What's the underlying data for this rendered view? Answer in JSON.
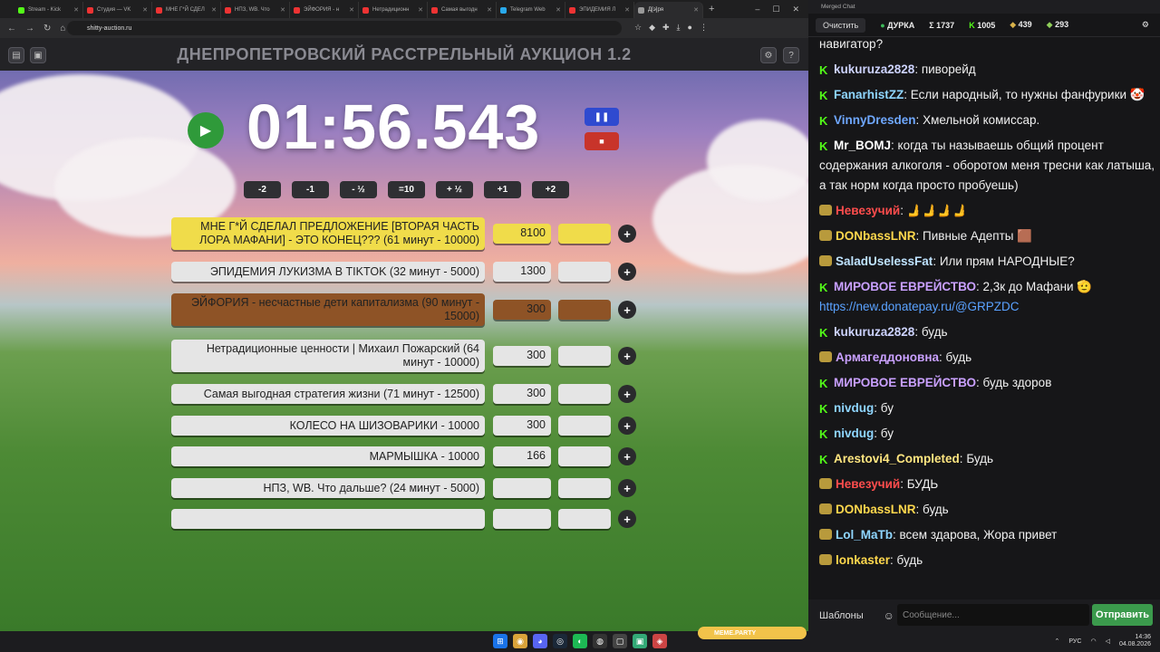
{
  "browser": {
    "tabs": [
      "Stream - Kick",
      "Студия — VK",
      "МНЕ Г*Й СДЕЛ",
      "НПЗ, WB. Что",
      "ЭЙФОРИЯ - н",
      "Нетрадиционн",
      "Самая выгодн",
      "Telegram Web",
      "ЭПИДЕМИЯ Л",
      "Д[э]ря"
    ],
    "url": "shitty-auction.ru"
  },
  "app": {
    "title": "ДНЕПРОПЕТРОВСКИЙ РАССТРЕЛЬНЫЙ АУКЦИОН 1.2",
    "timer": "01:56.543",
    "adjust": [
      "-2",
      "-1",
      "- ½",
      "=10",
      "+ ½",
      "+1",
      "+2"
    ],
    "lots": [
      {
        "name": "МНЕ Г*Й СДЕЛАЛ ПРЕДЛОЖЕНИЕ [ВТОРАЯ ЧАСТЬ ЛОРА МАФАНИ] - ЭТО КОНЕЦ??? (61 минут - 10000)",
        "sum": "8100",
        "style": "yellow"
      },
      {
        "name": "ЭПИДЕМИЯ ЛУКИЗМА В TIKTOK (32 минут - 5000)",
        "sum": "1300",
        "style": "gray"
      },
      {
        "name": "ЭЙФОРИЯ - несчастные дети капитализма (90 минут - 15000)",
        "sum": "300",
        "style": "brown"
      },
      {
        "name": "Нетрадиционные ценности | Михаил Пожарский (64 минут - 10000)",
        "sum": "300",
        "style": "gray"
      },
      {
        "name": "Самая выгодная стратегия жизни (71 минут - 12500)",
        "sum": "300",
        "style": "gray"
      },
      {
        "name": "КОЛЕСО НА ШИЗОВАРИКИ - 10000",
        "sum": "300",
        "style": "gray"
      },
      {
        "name": "МАРМЫШКА - 10000",
        "sum": "166",
        "style": "gray"
      },
      {
        "name": "НПЗ, WB. Что дальше? (24 минут - 5000)",
        "sum": "",
        "style": "gray"
      },
      {
        "name": "",
        "sum": "",
        "style": "gray"
      }
    ]
  },
  "chat": {
    "window_title": "Merged Chat",
    "clear_label": "Очистить",
    "channel": "ДУРКА",
    "stats": [
      "Σ 1737",
      "1005",
      "439",
      "293"
    ],
    "messages": [
      {
        "nick": "",
        "text": "навигатор?",
        "color": "#f0f0f0",
        "badge": "none"
      },
      {
        "nick": "kukuruza2828",
        "text": "пиворейд",
        "color": "#cdd3ff",
        "badge": "k"
      },
      {
        "nick": "FanarhistZZ",
        "text": "Если народный, то нужны фанфурики 🤡",
        "color": "#8fd6ff",
        "badge": "k"
      },
      {
        "nick": "VinnyDresden",
        "text": "Хмельной комиссар.",
        "color": "#6fa8ff",
        "badge": "k"
      },
      {
        "nick": "Mr_BOMJ",
        "text": "когда ты называешь общий процент содержания алкоголя - оборотом меня тресни как латыша, а так норм когда просто пробуешь)",
        "color": "#ffffff",
        "badge": "k"
      },
      {
        "nick": "Невезучий",
        "text": "🫸🫸🫸🫸",
        "color": "#ff4d4d",
        "badge": "hat"
      },
      {
        "nick": "DONbassLNR",
        "text": "Пивные Адепты 🟫",
        "color": "#ffd84d",
        "badge": "hat"
      },
      {
        "nick": "SaladUselessFat",
        "text": "Или прям НАРОДНЫЕ?",
        "color": "#bfe3ff",
        "badge": "hat"
      },
      {
        "nick": "МИРОВОЕ ЕВРЕЙСТВО",
        "text": "2,3к до Мафани 🫡",
        "color": "#c9a0ff",
        "badge": "k",
        "link": "https://new.donatepay.ru/@GRPZDC"
      },
      {
        "nick": "kukuruza2828",
        "text": "будь",
        "color": "#cdd3ff",
        "badge": "k"
      },
      {
        "nick": "Армагеддоновна",
        "text": "будь",
        "color": "#c9a0ff",
        "badge": "hat"
      },
      {
        "nick": "МИРОВОЕ ЕВРЕЙСТВО",
        "text": "будь здоров",
        "color": "#c9a0ff",
        "badge": "k"
      },
      {
        "nick": "nivdug",
        "text": "бу",
        "color": "#8fd6ff",
        "badge": "k"
      },
      {
        "nick": "nivdug",
        "text": "бу",
        "color": "#8fd6ff",
        "badge": "k"
      },
      {
        "nick": "Arestovi4_Completed",
        "text": "Будь",
        "color": "#ffe680",
        "badge": "k"
      },
      {
        "nick": "Невезучий",
        "text": "БУДЬ",
        "color": "#ff4d4d",
        "badge": "hat"
      },
      {
        "nick": "DONbassLNR",
        "text": "будь",
        "color": "#ffd84d",
        "badge": "hat"
      },
      {
        "nick": "Lol_MaTb",
        "text": "всем здарова, Жора привет",
        "color": "#8fd6ff",
        "badge": "hat"
      },
      {
        "nick": "lonkaster",
        "text": "будь",
        "color": "#ffd84d",
        "badge": "hat"
      }
    ],
    "templates_label": "Шаблоны",
    "input_placeholder": "Сообщение...",
    "send_label": "Отправить"
  },
  "taskbar": {
    "lang": "РУС",
    "time": "14:36",
    "date": "04.08.2026",
    "meme": "MEME.PARTY"
  }
}
